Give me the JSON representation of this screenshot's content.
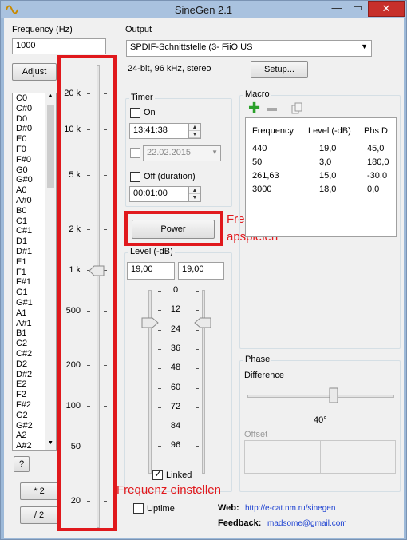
{
  "window": {
    "title": "SineGen 2.1",
    "close_label": "✕",
    "min_label": "—",
    "max_label": "▭"
  },
  "frequency": {
    "label": "Frequency (Hz)",
    "value": "1000",
    "adjust_label": "Adjust",
    "help_label": "?",
    "double_label": "* 2",
    "half_label": "/ 2"
  },
  "notes": [
    "C0",
    "C#0",
    "D0",
    "D#0",
    "E0",
    "F0",
    "F#0",
    "G0",
    "G#0",
    "A0",
    "A#0",
    "B0",
    "C1",
    "C#1",
    "D1",
    "D#1",
    "E1",
    "F1",
    "F#1",
    "G1",
    "G#1",
    "A1",
    "A#1",
    "B1",
    "C2",
    "C#2",
    "D2",
    "D#2",
    "E2",
    "F2",
    "F#2",
    "G2",
    "G#2",
    "A2",
    "A#2"
  ],
  "freq_scale": {
    "ticks": [
      "20 k",
      "10 k",
      "5 k",
      "2 k",
      "1 k",
      "500",
      "200",
      "100",
      "50",
      "20"
    ],
    "slider_value": "1 k"
  },
  "output": {
    "label": "Output",
    "device": "SPDIF-Schnittstelle (3- FiiO US",
    "format": "24-bit, 96 kHz, stereo",
    "setup_label": "Setup..."
  },
  "timer": {
    "label": "Timer",
    "on_label": "On",
    "time": "13:41:38",
    "date": "22.02.2015",
    "off_label": "Off (duration)",
    "duration": "00:01:00"
  },
  "power": {
    "label": "Power"
  },
  "level": {
    "label": "Level (-dB)",
    "left": "19,00",
    "right": "19,00",
    "ticks": [
      "0",
      "12",
      "24",
      "36",
      "48",
      "60",
      "72",
      "84",
      "96"
    ],
    "linked_label": "Linked"
  },
  "macro": {
    "label": "Macro",
    "add_icon": "plus-icon",
    "remove_icon": "minus-icon",
    "copy_icon": "copy-icon",
    "columns": [
      "Frequency",
      "Level (-dB)",
      "Phs D"
    ],
    "rows": [
      [
        "440",
        "19,0",
        "45,0"
      ],
      [
        "50",
        "3,0",
        "180,0"
      ],
      [
        "261,63",
        "15,0",
        "-30,0"
      ],
      [
        "3000",
        "18,0",
        "0,0"
      ]
    ]
  },
  "phase": {
    "label": "Phase",
    "difference_label": "Difference",
    "value": "40°",
    "offset_label": "Offset"
  },
  "uptime": {
    "label": "Uptime"
  },
  "footer": {
    "web_label": "Web:",
    "web_url": "http://e-cat.nm.ru/sinegen",
    "feedback_label": "Feedback:",
    "feedback_email": "madsome@gmail.com"
  },
  "annotations": {
    "freq_play": "Frequenzen\napspielen",
    "freq_set": "Frequenz einstellen"
  },
  "colors": {
    "highlight": "#e0181c",
    "link": "#1a3fd1",
    "plus": "#2aa02a"
  }
}
